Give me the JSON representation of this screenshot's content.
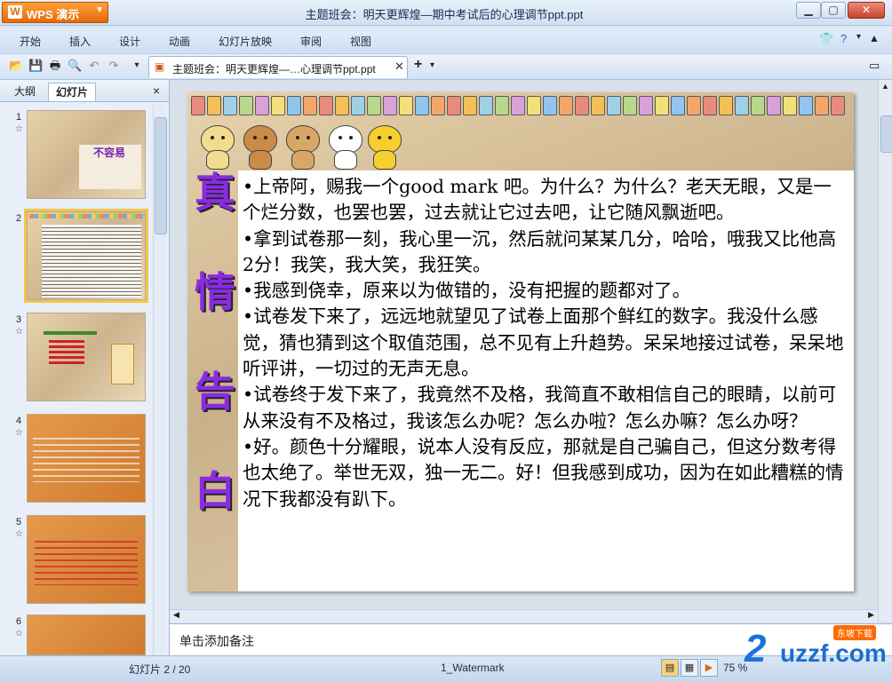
{
  "app": {
    "name": "WPS 演示",
    "window_title": "主题班会：明天更辉煌—期中考试后的心理调节ppt.ppt"
  },
  "menu": [
    "开始",
    "插入",
    "设计",
    "动画",
    "幻灯片放映",
    "审阅",
    "视图"
  ],
  "toolbar": {
    "doc_tab_label": "主题班会：明天更辉煌—…心理调节ppt.ppt",
    "new_tab": "+"
  },
  "panel": {
    "tabs": [
      "大纲",
      "幻灯片"
    ],
    "close": "×"
  },
  "thumbnails": [
    {
      "num": "1",
      "title": "不容易"
    },
    {
      "num": "2",
      "title": ""
    },
    {
      "num": "3",
      "title": ""
    },
    {
      "num": "4",
      "title": ""
    },
    {
      "num": "5",
      "title": ""
    },
    {
      "num": "6",
      "title": ""
    }
  ],
  "slide": {
    "vertical_title": [
      "真",
      "情",
      "告",
      "白"
    ],
    "text": "•上帝阿，赐我一个good mark 吧。为什么？为什么？老天无眼，又是一个烂分数，也罢也罢，过去就让它过去吧，让它随风飘逝吧。\n•拿到试卷那一刻，我心里一沉，然后就问某某几分，哈哈，哦我又比他高2分！我笑，我大笑，我狂笑。\n•我感到侥幸，原来以为做错的，没有把握的题都对了。\n•试卷发下来了，远远地就望见了试卷上面那个鲜红的数字。我没什么感觉，猜也猜到这个取值范围，总不见有上升趋势。呆呆地接过试卷，呆呆地听评讲，一切过的无声无息。\n•试卷终于发下来了，我竟然不及格，我简直不敢相信自己的眼睛，以前可从来没有不及格过，我该怎么办呢？怎么办啦？怎么办嘛？怎么办呀？\n•好。颜色十分耀眼，说本人没有反应，那就是自己骗自己，但这分数考得也太绝了。举世无双，独一无二。好！但我感到成功，因为在如此糟糕的情况下我都没有趴下。"
  },
  "notes_placeholder": "单击添加备注",
  "status": {
    "slide_counter": "幻灯片 2 / 20",
    "template": "1_Watermark",
    "zoom": "75 %"
  },
  "watermark": {
    "brand": "uzzf.com",
    "tag": "东坡下载"
  }
}
